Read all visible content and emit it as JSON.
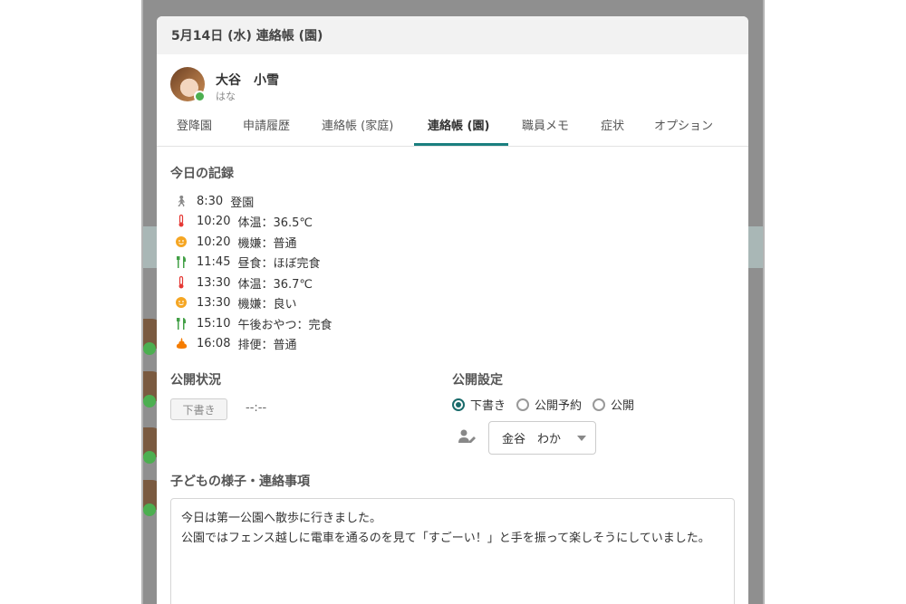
{
  "modal": {
    "title": "5月14日 (水) 連絡帳 (園)"
  },
  "profile": {
    "name": "大谷　小雪",
    "nickname": "はな",
    "status_color": "#4caf50"
  },
  "tabs": [
    {
      "label": "登降園",
      "active": false
    },
    {
      "label": "申請履歴",
      "active": false
    },
    {
      "label": "連絡帳 (家庭)",
      "active": false
    },
    {
      "label": "連絡帳 (園)",
      "active": true
    },
    {
      "label": "職員メモ",
      "active": false
    },
    {
      "label": "症状",
      "active": false
    },
    {
      "label": "オプション",
      "active": false
    }
  ],
  "today_record": {
    "label": "今日の記録",
    "items": [
      {
        "icon": "walk-icon",
        "time": "8:30",
        "text": "登園",
        "color": "#888888"
      },
      {
        "icon": "thermometer-icon",
        "time": "10:20",
        "text": "体温：36.5℃",
        "color": "#e53935"
      },
      {
        "icon": "smile-icon",
        "time": "10:20",
        "text": "機嫌：普通",
        "color": "#f5a623"
      },
      {
        "icon": "utensils-icon",
        "time": "11:45",
        "text": "昼食：ほぼ完食",
        "color": "#43a047"
      },
      {
        "icon": "thermometer-icon",
        "time": "13:30",
        "text": "体温：36.7℃",
        "color": "#e53935"
      },
      {
        "icon": "smile-icon",
        "time": "13:30",
        "text": "機嫌：良い",
        "color": "#f5a623"
      },
      {
        "icon": "utensils-icon",
        "time": "15:10",
        "text": "午後おやつ：完食",
        "color": "#43a047"
      },
      {
        "icon": "poop-icon",
        "time": "16:08",
        "text": "排便：普通",
        "color": "#f57c00"
      }
    ]
  },
  "publish_status": {
    "label": "公開状況",
    "badge": "下書き",
    "time": "--:--"
  },
  "publish_settings": {
    "label": "公開設定",
    "options": [
      {
        "label": "下書き",
        "checked": true
      },
      {
        "label": "公開予約",
        "checked": false
      },
      {
        "label": "公開",
        "checked": false
      }
    ],
    "staff_select": "金谷　わか"
  },
  "notes": {
    "label": "子どもの様子・連絡事項",
    "text": "今日は第一公園へ散歩に行きました。\n公園ではフェンス越しに電車を通るのを見て「すごーい！」と手を振って楽しそうにしていました。"
  },
  "colors": {
    "accent": "#1a7f7f",
    "radio": "#1a6b6b"
  }
}
